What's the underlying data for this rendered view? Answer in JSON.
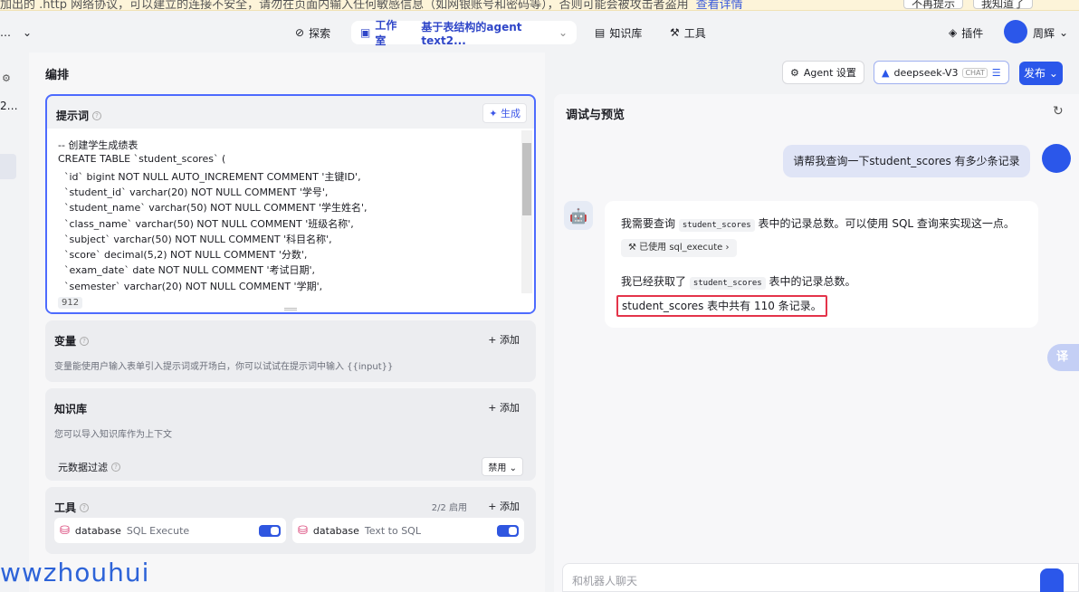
{
  "banner": {
    "text": "加出的 .http 网络协议，可以建立的连接不安全，请勿在页面内输入任何敏感信息（如网银账号和密码等），否则可能会被攻击者盗用",
    "link": "查看详情",
    "btn1": "不再提示",
    "btn2": "我知道了"
  },
  "topnav": {
    "left_arrow": "⌄",
    "explore": "探索",
    "studio": "工作室",
    "studio_sub": "基于表结构的agent text2...",
    "knowledge": "知识库",
    "tools": "工具",
    "plugins": "插件",
    "user": "周辉"
  },
  "editor": {
    "title": "编排",
    "prompt_label": "提示词",
    "generate": "生成",
    "code_lines": [
      "-- 创建学生成绩表",
      "CREATE TABLE `student_scores` (",
      "  `id` bigint NOT NULL AUTO_INCREMENT COMMENT '主键ID',",
      "  `student_id` varchar(20) NOT NULL COMMENT '学号',",
      "  `student_name` varchar(50) NOT NULL COMMENT '学生姓名',",
      "  `class_name` varchar(50) NOT NULL COMMENT '班级名称',",
      "  `subject` varchar(50) NOT NULL COMMENT '科目名称',",
      "  `score` decimal(5,2) NOT NULL COMMENT '分数',",
      "  `exam_date` date NOT NULL COMMENT '考试日期',",
      "  `semester` varchar(20) NOT NULL COMMENT '学期',"
    ],
    "char_count": "912",
    "variables": {
      "title": "变量",
      "add": "+ 添加",
      "desc": "变量能使用户输入表单引入提示词或开场白，你可以试试在提示词中输入 {{input}}"
    },
    "knowledge": {
      "title": "知识库",
      "add": "+ 添加",
      "desc": "您可以导入知识库作为上下文",
      "filter": "元数据过滤",
      "filter_value": "禁用"
    },
    "tools": {
      "title": "工具",
      "enabled": "2/2 启用",
      "add": "+ 添加",
      "items": [
        {
          "name": "database",
          "desc": "SQL Execute"
        },
        {
          "name": "database",
          "desc": "Text to SQL"
        }
      ]
    }
  },
  "header_right": {
    "agent_settings": "Agent 设置",
    "model": "deepseek-V3",
    "model_tag": "CHAT",
    "publish": "发布"
  },
  "preview": {
    "title": "调试与预览",
    "user_message": "请帮我查询一下student_scores 有多少条记录",
    "bot": {
      "line1_pre": "我需要查询",
      "line1_code": "student_scores",
      "line1_post": "表中的记录总数。可以使用 SQL 查询来实现这一点。",
      "tool_used": "已使用 sql_execute",
      "line2_pre": "我已经获取了",
      "line2_code": "student_scores",
      "line2_post": "表中的记录总数。",
      "answer": "student_scores 表中共有 110 条记录。"
    },
    "input_placeholder": "和机器人聊天",
    "translate": "译"
  },
  "watermark": "wwzhouhui"
}
